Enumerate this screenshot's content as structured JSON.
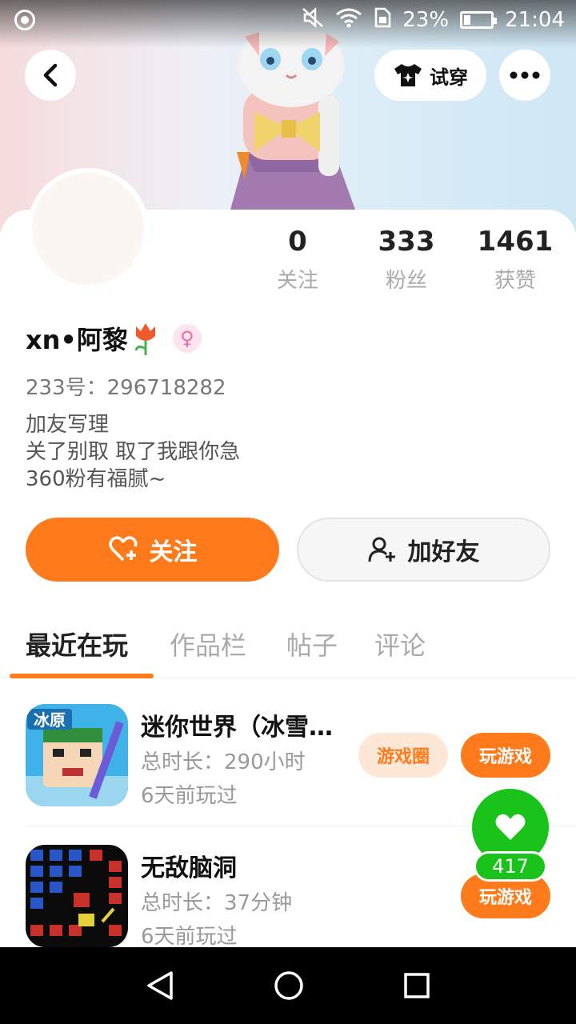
{
  "status_bar": {
    "battery_percent": "23%",
    "battery_level": 0.23,
    "time": "21:04",
    "icons": [
      "camera-icon",
      "mute-icon",
      "wifi-icon",
      "sim-icon",
      "battery-icon"
    ]
  },
  "header": {
    "try_on_label": "试穿"
  },
  "stats": [
    {
      "value": "0",
      "label": "关注"
    },
    {
      "value": "333",
      "label": "粉丝"
    },
    {
      "value": "1461",
      "label": "获赞"
    }
  ],
  "profile": {
    "name": "xn•阿黎",
    "uid": "233号：296718282",
    "bio_lines": [
      "加友写理",
      "关了别取 取了我跟你急",
      "360粉有福腻~"
    ]
  },
  "actions": {
    "follow_label": "关注",
    "add_friend_label": "加好友"
  },
  "tabs": [
    {
      "label": "最近在玩",
      "active": true
    },
    {
      "label": "作品栏",
      "active": false
    },
    {
      "label": "帖子",
      "active": false
    },
    {
      "label": "评论",
      "active": false
    }
  ],
  "games": [
    {
      "title": "迷你世界（冰雪…",
      "playtime": "总时长：290小时",
      "last_played": "6天前玩过",
      "circle_label": "游戏圈",
      "play_label": "玩游戏",
      "icon_text": "冰原"
    },
    {
      "title": "无敌脑洞",
      "playtime": "总时长：37分钟",
      "last_played": "6天前玩过",
      "play_label": "玩游戏"
    }
  ],
  "like_float": {
    "count": "417"
  },
  "colors": {
    "accent": "#ff7a1a",
    "like_green": "#19c31a"
  }
}
